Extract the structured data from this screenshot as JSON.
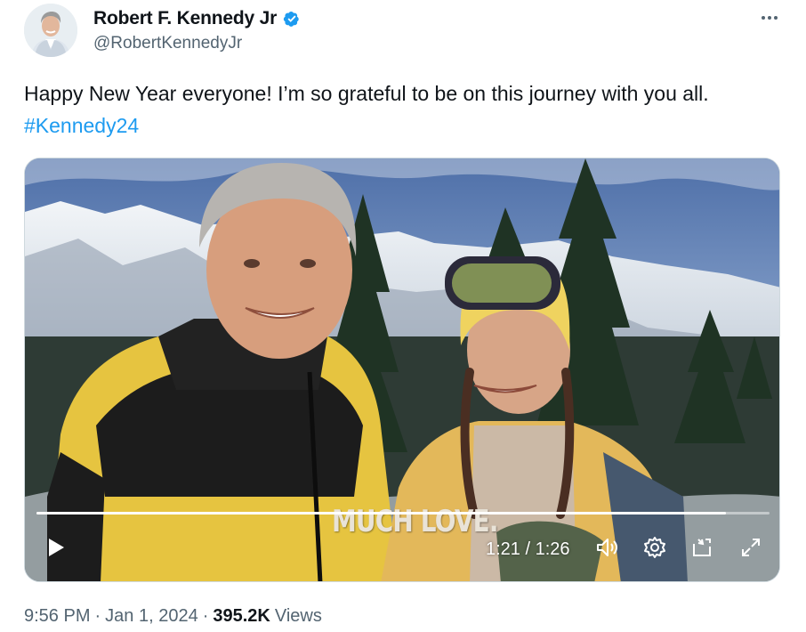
{
  "author": {
    "display_name": "Robert F. Kennedy Jr",
    "handle": "@RobertKennedyJr",
    "verified": true,
    "verified_color": "#1d9bf0"
  },
  "more_icon": "more-horizontal-icon",
  "tweet": {
    "text": "Happy New Year everyone! I’m so grateful to be on this journey with you all. ",
    "hashtag": "#Kennedy24",
    "hashtag_color": "#1d9bf0"
  },
  "video": {
    "caption": "MUCH LOVE.",
    "time_display": "1:21 / 1:26",
    "progress_fraction": 0.94,
    "controls": [
      "play-icon",
      "volume-icon",
      "settings-gear-icon",
      "picture-in-picture-icon",
      "fullscreen-icon"
    ]
  },
  "footer": {
    "time": "9:56 PM",
    "separator1": "·",
    "date": "Jan 1, 2024",
    "separator2": "·",
    "views_count": "395.2K",
    "views_label": "Views"
  }
}
